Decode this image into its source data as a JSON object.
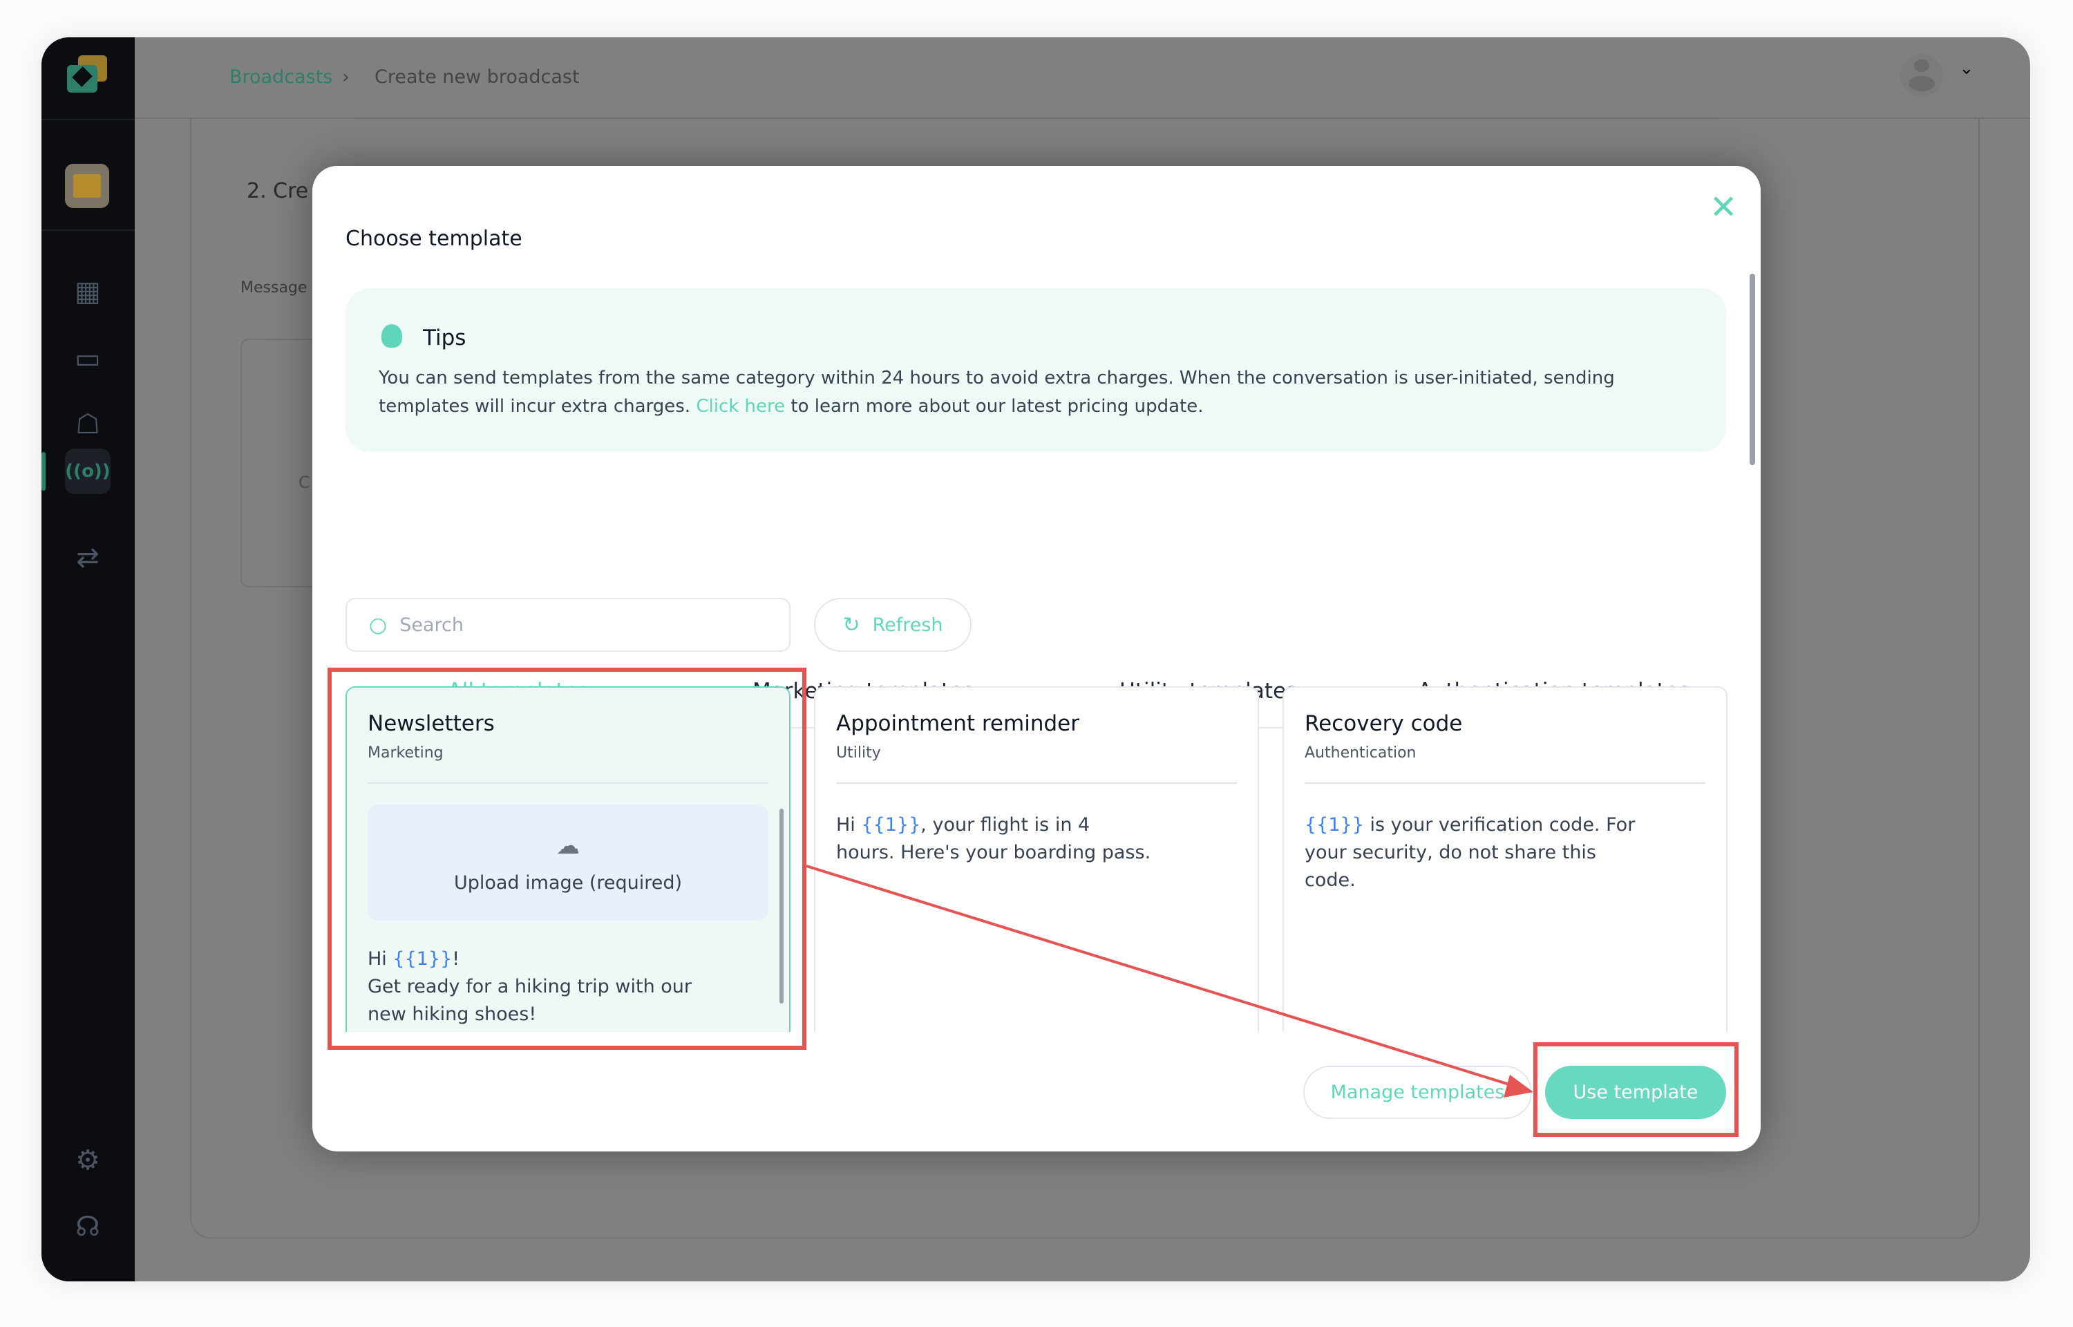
{
  "breadcrumb": {
    "parent": "Broadcasts",
    "current": "Create new broadcast"
  },
  "background": {
    "step_title": "2. Cre",
    "message_label": "Message t",
    "char": "C"
  },
  "sidebar": {
    "items": [
      {
        "icon": "dashboard-icon"
      },
      {
        "icon": "inbox-icon"
      },
      {
        "icon": "contacts-icon"
      },
      {
        "icon": "broadcast-icon",
        "active": true
      },
      {
        "icon": "flows-icon"
      },
      {
        "icon": "settings-icon"
      },
      {
        "icon": "headset-icon"
      }
    ]
  },
  "modal": {
    "title": "Choose template",
    "tips": {
      "title": "Tips",
      "text_before": "You can send templates from the same category within 24 hours to avoid extra charges. When the conversation is user-initiated, sending templates will incur extra charges. ",
      "link": "Click here",
      "text_after": " to learn more about our latest pricing update."
    },
    "tabs": [
      {
        "label": "All templates",
        "active": true
      },
      {
        "label": "Marketing templates"
      },
      {
        "label": "Utility templates"
      },
      {
        "label": "Authentication templates"
      }
    ],
    "search_placeholder": "Search",
    "refresh_label": "Refresh",
    "cards": [
      {
        "title": "Newsletters",
        "category": "Marketing",
        "upload_label": "Upload image (required)",
        "greeting": "Hi ",
        "var": "{{1}}",
        "greeting_end": "!",
        "body": "Get ready for a hiking trip with our new hiking shoes!",
        "selected": true
      },
      {
        "title": "Appointment reminder",
        "category": "Utility",
        "pre": "Hi ",
        "var": "{{1}}",
        "post": ", your flight is in 4 hours. Here's your boarding pass."
      },
      {
        "title": "Recovery code",
        "category": "Authentication",
        "pre": "",
        "var": "{{1}}",
        "post": " is your verification code. For your security, do not share this code."
      }
    ],
    "manage_label": "Manage templates",
    "use_label": "Use template"
  },
  "colors": {
    "accent": "#67d9c0",
    "annotation": "#e55353",
    "sidebar": "#0b0d10"
  }
}
